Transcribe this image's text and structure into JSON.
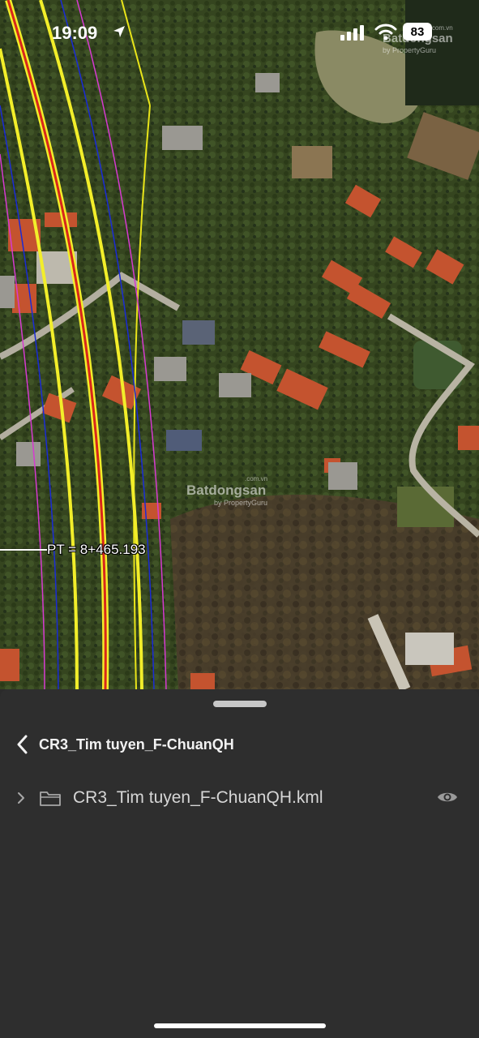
{
  "status_bar": {
    "time": "19:09",
    "battery": "83"
  },
  "map": {
    "watermark_brand": "Batdongsan",
    "watermark_sub": "by PropertyGuru",
    "watermark_tld": ".com.vn",
    "station_label": "PT = 8+465.193",
    "line_colors": {
      "centerline": "#d8261c",
      "edge": "#f2ee2a",
      "boundary": "#1a2bd6",
      "offset": "#d63ad0",
      "parcel": "#e9e51a"
    }
  },
  "sheet": {
    "title": "CR3_Tim tuyen_F-ChuanQH",
    "items": [
      {
        "label": "CR3_Tim tuyen_F-ChuanQH.kml",
        "icon": "folder-icon",
        "visibility": "eye-icon"
      }
    ]
  }
}
